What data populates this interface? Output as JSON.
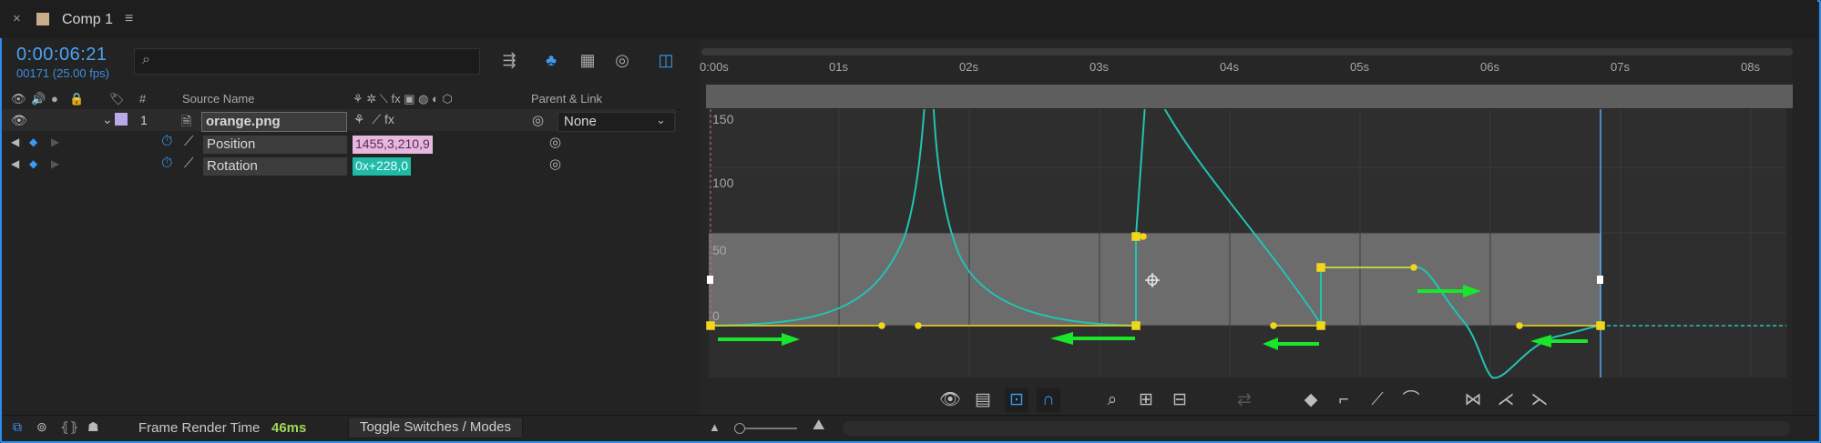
{
  "tab": {
    "close": "×",
    "title": "Comp 1",
    "menu": "≡",
    "swatch_color": "#c9ad8a"
  },
  "timecode": "0:00:06:21",
  "fps": "00171 (25.00 fps)",
  "search": {
    "icon": "search-icon",
    "glyph": "⌕",
    "value": ""
  },
  "columns": {
    "num": "#",
    "source": "Source Name",
    "parent": "Parent & Link"
  },
  "layer": {
    "index": "1",
    "name": "orange.png",
    "parent": "None",
    "label_color": "#b9a9e6"
  },
  "properties": [
    {
      "name": "Position",
      "value": "1455,3,210,9"
    },
    {
      "name": "Rotation",
      "value": "0x+228,0"
    }
  ],
  "ruler": [
    "0:00s",
    "01s",
    "02s",
    "03s",
    "04s",
    "05s",
    "06s",
    "07s",
    "08s"
  ],
  "graph_values": [
    "150",
    "100",
    "50",
    "0"
  ],
  "bottom": {
    "render_label": "Frame Render Time",
    "render_value": "46ms",
    "toggle": "Toggle Switches / Modes"
  },
  "colors": {
    "accent": "#2d8ceb",
    "curve": "#22c3b3",
    "keyframe": "#f2d61a",
    "arrow": "#19e62b",
    "render_ok": "#9ed85a"
  }
}
